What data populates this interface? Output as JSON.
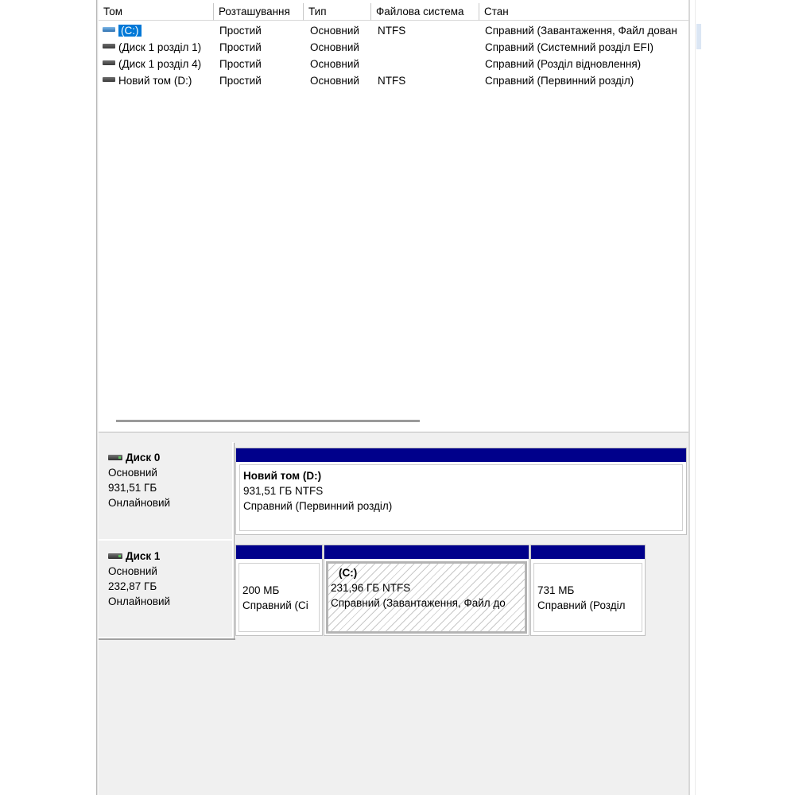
{
  "columns": [
    "Том",
    "Розташування",
    "Тип",
    "Файлова система",
    "Стан"
  ],
  "volumes": [
    {
      "name": "(C:)",
      "layout": "Простий",
      "type": "Основний",
      "fs": "NTFS",
      "status": "Справний (Завантаження, Файл дован",
      "icon": "volume-blue-icon",
      "selected": true
    },
    {
      "name": "(Диск 1 розділ 1)",
      "layout": "Простий",
      "type": "Основний",
      "fs": "",
      "status": "Справний (Системний розділ EFI)",
      "icon": "volume-gray-icon"
    },
    {
      "name": "(Диск 1 розділ 4)",
      "layout": "Простий",
      "type": "Основний",
      "fs": "",
      "status": "Справний (Розділ відновлення)",
      "icon": "volume-gray-icon"
    },
    {
      "name": "Новий том (D:)",
      "layout": "Простий",
      "type": "Основний",
      "fs": "NTFS",
      "status": "Справний (Первинний розділ)",
      "icon": "volume-gray-icon"
    }
  ],
  "disks": [
    {
      "name": "Диск 0",
      "type": "Основний",
      "size": "931,51 ГБ",
      "state": "Онлайновий",
      "partitions": [
        {
          "title": "Новий том  (D:)",
          "size": "931,51 ГБ NTFS",
          "status": "Справний (Первинний розділ)"
        }
      ]
    },
    {
      "name": "Диск 1",
      "type": "Основний",
      "size": "232,87 ГБ",
      "state": "Онлайновий",
      "partitions": [
        {
          "title": "",
          "size": "200 МБ",
          "status": "Справний (Сі"
        },
        {
          "title": "(C:)",
          "size": "231,96 ГБ NTFS",
          "status": "Справний (Завантаження, Файл до"
        },
        {
          "title": "",
          "size": "731 МБ",
          "status": "Справний (Розділ"
        }
      ]
    }
  ],
  "colors": {
    "partition_bar": "#00008b",
    "selection": "#0078d7"
  }
}
